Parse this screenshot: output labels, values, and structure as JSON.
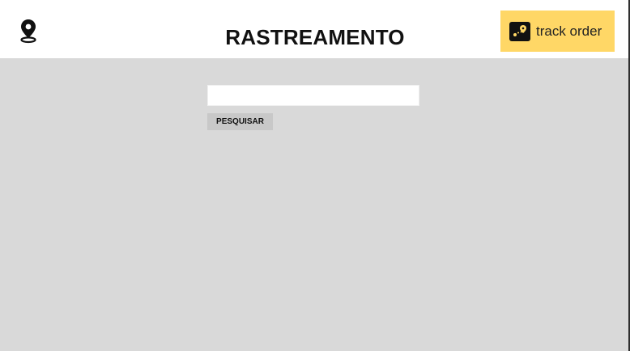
{
  "header": {
    "title": "RASTREAMENTO",
    "location_icon": "location-pin-icon",
    "badge": {
      "label": "track order",
      "icon": "map-route-icon",
      "background": "#ffd766"
    }
  },
  "search": {
    "value": "",
    "placeholder": "",
    "button_label": "PESQUISAR"
  },
  "colors": {
    "page_background": "#d9d9d9",
    "header_background": "#ffffff",
    "button_background": "#c8c8c8",
    "text": "#111111"
  }
}
